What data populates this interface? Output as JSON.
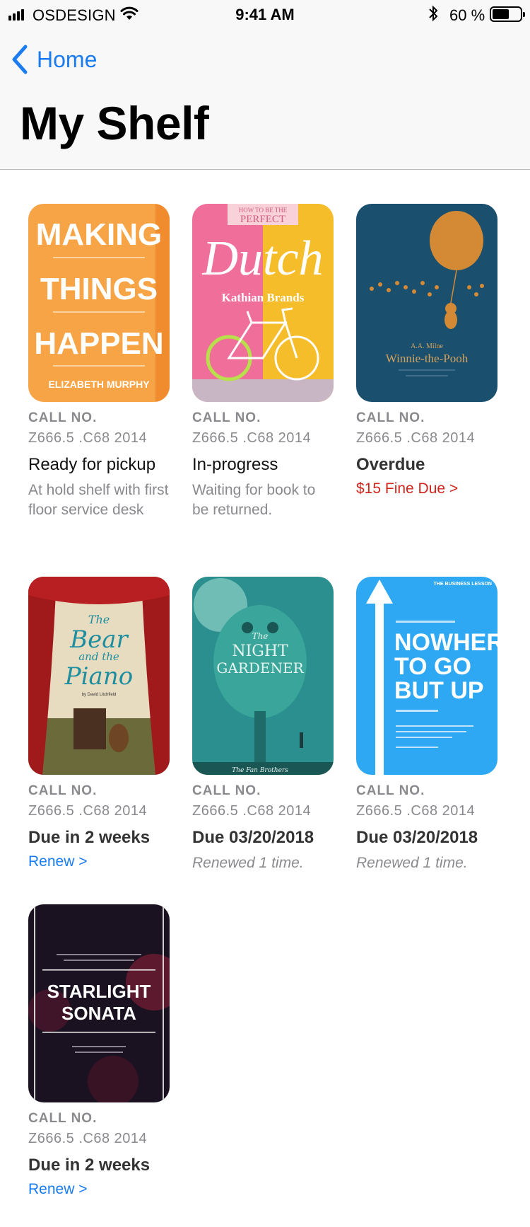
{
  "status_bar": {
    "carrier": "OSDESIGN",
    "time": "9:41 AM",
    "battery_percent": "60 %",
    "battery_level": 0.6
  },
  "nav": {
    "back_label": "Home",
    "title": "My Shelf"
  },
  "books": [
    {
      "cover_text": [
        "MAKING",
        "THINGS",
        "HAPPEN",
        "ELIZABETH MURPHY"
      ],
      "call_label": "CALL NO.",
      "call_number": "Z666.5 .C68 2014",
      "status": "Ready for pickup",
      "detail": "At hold shelf with first floor service desk"
    },
    {
      "cover_text": [
        "HOW TO BE THE",
        "PERFECT",
        "Dutch",
        "Kathian Brands"
      ],
      "call_label": "CALL NO.",
      "call_number": "Z666.5 .C68 2014",
      "status": "In-progress",
      "detail": "Waiting for book to be returned."
    },
    {
      "cover_text": [
        "A.A. Milne",
        "Winnie-the-Pooh"
      ],
      "call_label": "CALL NO.",
      "call_number": "Z666.5 .C68 2014",
      "status": "Overdue",
      "action": "$15 Fine Due >"
    },
    {
      "cover_text": [
        "The",
        "Bear",
        "and the",
        "Piano",
        "by David Litchfield"
      ],
      "call_label": "CALL NO.",
      "call_number": "Z666.5 .C68 2014",
      "status": "Due in 2 weeks",
      "action": "Renew >"
    },
    {
      "cover_text": [
        "The",
        "NIGHT",
        "GARDENER",
        "The Fan Brothers"
      ],
      "call_label": "CALL NO.",
      "call_number": "Z666.5 .C68 2014",
      "status": "Due 03/20/2018",
      "detail": "Renewed 1 time."
    },
    {
      "cover_text": [
        "THE BUSINESS LESSON",
        "NOWHERE",
        "TO GO",
        "BUT UP"
      ],
      "call_label": "CALL NO.",
      "call_number": "Z666.5 .C68 2014",
      "status": "Due 03/20/2018",
      "detail": "Renewed 1 time."
    },
    {
      "cover_text": [
        "STARLIGHT",
        "SONATA"
      ],
      "call_label": "CALL NO.",
      "call_number": "Z666.5 .C68 2014",
      "status": "Due in 2 weeks",
      "action": "Renew >"
    }
  ],
  "colors": {
    "accent": "#1a7cf0",
    "alert": "#d0241c",
    "secondary_text": "#8a8a8e"
  }
}
